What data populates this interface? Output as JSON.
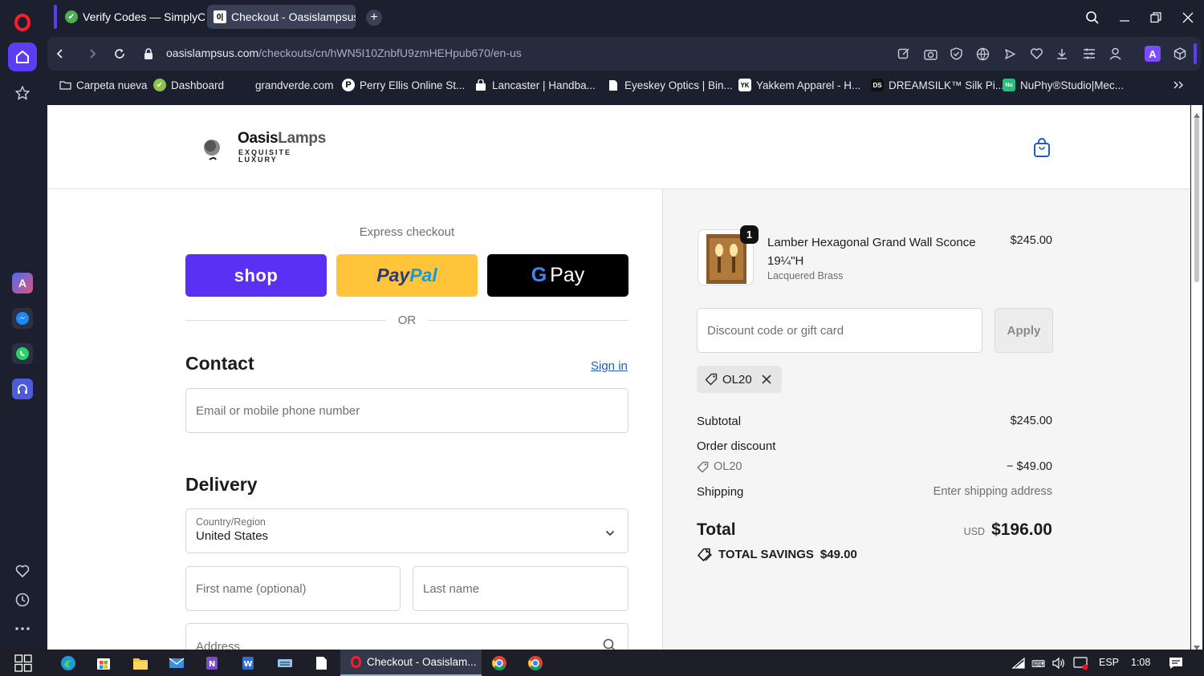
{
  "browser": {
    "tabs": [
      {
        "label": "Verify Codes — SimplyCod"
      },
      {
        "label": "Checkout - Oasislampsus",
        "badge": "0|"
      }
    ],
    "url_domain": "oasislampsus.com",
    "url_path": "/checkouts/cn/hWN5I10ZnbfU9zmHEHpub670/en-us",
    "bookmarks": [
      {
        "label": "Carpeta nueva"
      },
      {
        "label": "Dashboard"
      },
      {
        "label": "grandverde.com"
      },
      {
        "label": "Perry Ellis Online St...",
        "icon_text": "P"
      },
      {
        "label": "Lancaster | Handba..."
      },
      {
        "label": "Eyeskey Optics | Bin..."
      },
      {
        "label": "Yakkem Apparel - H...",
        "icon_text": "YK"
      },
      {
        "label": "DREAMSILK™ Silk Pi...",
        "icon_text": "DS"
      },
      {
        "label": "NuPhy®Studio|Mec...",
        "icon_text": "Nu"
      }
    ]
  },
  "store": {
    "logo_name_bold": "Oasis",
    "logo_name_light": "Lamps",
    "logo_tagline_1": "EXQUISITE",
    "logo_tagline_2": "LUXURY"
  },
  "checkout": {
    "express_label": "Express checkout",
    "shop_label": "shop",
    "paypal_label_1": "Pay",
    "paypal_label_2": "Pal",
    "gpay_g": "G",
    "gpay_label": "Pay",
    "or_label": "OR",
    "contact_heading": "Contact",
    "sign_in": "Sign in",
    "email_placeholder": "Email or mobile phone number",
    "delivery_heading": "Delivery",
    "country_label": "Country/Region",
    "country_value": "United States",
    "first_name_placeholder": "First name (optional)",
    "last_name_placeholder": "Last name",
    "address_placeholder": "Address"
  },
  "summary": {
    "item_qty": "1",
    "item_name": "Lamber Hexagonal Grand Wall Sconce 19¼\"H",
    "item_variant": "Lacquered Brass",
    "item_price": "$245.00",
    "discount_placeholder": "Discount code or gift card",
    "apply_label": "Apply",
    "applied_code": "OL20",
    "subtotal_label": "Subtotal",
    "subtotal_value": "$245.00",
    "order_discount_label": "Order discount",
    "discount_code": "OL20",
    "discount_value": "− $49.00",
    "shipping_label": "Shipping",
    "shipping_value": "Enter shipping address",
    "total_label": "Total",
    "total_currency": "USD",
    "total_value": "$196.00",
    "savings_label": "TOTAL SAVINGS",
    "savings_value": "$49.00"
  },
  "taskbar": {
    "active_app_label": "Checkout - Oasislam...",
    "language": "ESP",
    "time": "1:08"
  },
  "colors": {
    "shop_purple": "#5a31f4",
    "paypal_yellow": "#ffc439",
    "link_blue": "#1f5bc7",
    "opera_red": "#ff1b2d"
  }
}
